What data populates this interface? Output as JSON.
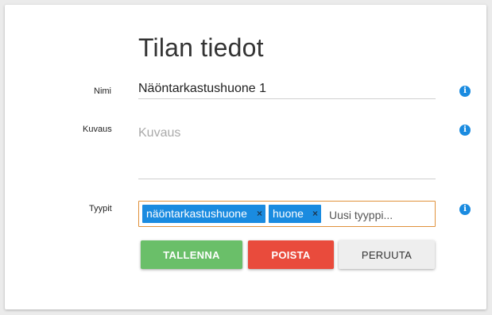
{
  "form": {
    "title": "Tilan tiedot",
    "name_label": "Nimi",
    "name_value": "Näöntarkastushuone 1",
    "description_label": "Kuvaus",
    "description_placeholder": "Kuvaus",
    "description_value": "",
    "types_label": "Tyypit",
    "types": [
      {
        "label": "näöntarkastushuone",
        "remove": "×"
      },
      {
        "label": "huone",
        "remove": "×"
      }
    ],
    "types_placeholder": "Uusi tyyppi...",
    "info_icon_glyph": "i"
  },
  "buttons": {
    "save_label": "TALLENNA",
    "delete_label": "POISTA",
    "cancel_label": "PERUUTA"
  },
  "colors": {
    "accent_blue": "#1a8be0",
    "save_green": "#6abf69",
    "delete_red": "#e94b3c",
    "cancel_gray": "#eeeeee",
    "focus_orange": "#e0913b"
  }
}
